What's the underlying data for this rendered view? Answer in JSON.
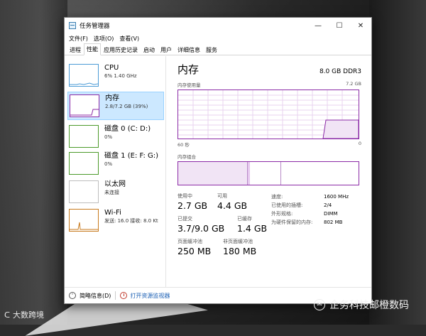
{
  "window": {
    "title": "任务管理器",
    "controls": [
      "—",
      "☐",
      "✕"
    ]
  },
  "menu": [
    "文件(F)",
    "选项(O)",
    "查看(V)"
  ],
  "tabs": [
    "进程",
    "性能",
    "应用历史记录",
    "启动",
    "用户",
    "详细信息",
    "服务"
  ],
  "active_tab": "性能",
  "sidebar": {
    "items": [
      {
        "name": "CPU",
        "sub": "6% 1.40 GHz"
      },
      {
        "name": "内存",
        "sub": "2.8/7.2 GB (39%)"
      },
      {
        "name": "磁盘 0 (C: D:)",
        "sub": "0%"
      },
      {
        "name": "磁盘 1 (E: F: G:)",
        "sub": "0%"
      },
      {
        "name": "以太网",
        "sub": "未连接"
      },
      {
        "name": "Wi-Fi",
        "sub": "发送: 16.0 接收: 8.0 Kt"
      }
    ]
  },
  "main": {
    "title": "内存",
    "spec": "8.0 GB DDR3",
    "graph_label": "内存使用量",
    "graph_max": "7.2 GB",
    "graph_time": "60 秒",
    "graph_min": "0",
    "composition_label": "内存组合"
  },
  "stats": {
    "in_use_label": "使用中",
    "in_use": "2.7 GB",
    "available_label": "可用",
    "available": "4.4 GB",
    "committed_label": "已提交",
    "committed": "3.7/9.0 GB",
    "cached_label": "已缓存",
    "cached": "1.4 GB",
    "paged_label": "页面缓冲池",
    "paged": "250 MB",
    "nonpaged_label": "非页面缓冲池",
    "nonpaged": "180 MB",
    "details": [
      {
        "k": "速度:",
        "v": "1600 MHz"
      },
      {
        "k": "已使用的插槽:",
        "v": "2/4"
      },
      {
        "k": "外形规格:",
        "v": "DIMM"
      },
      {
        "k": "为硬件保留的内存:",
        "v": "802 MB"
      }
    ]
  },
  "footer": {
    "brief": "简略信息(D)",
    "open_monitor": "打开资源监视器"
  },
  "watermarks": {
    "left": "大数跨境",
    "right": "企务科技邮橙数码"
  },
  "colors": {
    "memory_accent": "#8b2aa6",
    "cpu_accent": "#4b9bd6",
    "selected_bg": "#cce8ff"
  }
}
